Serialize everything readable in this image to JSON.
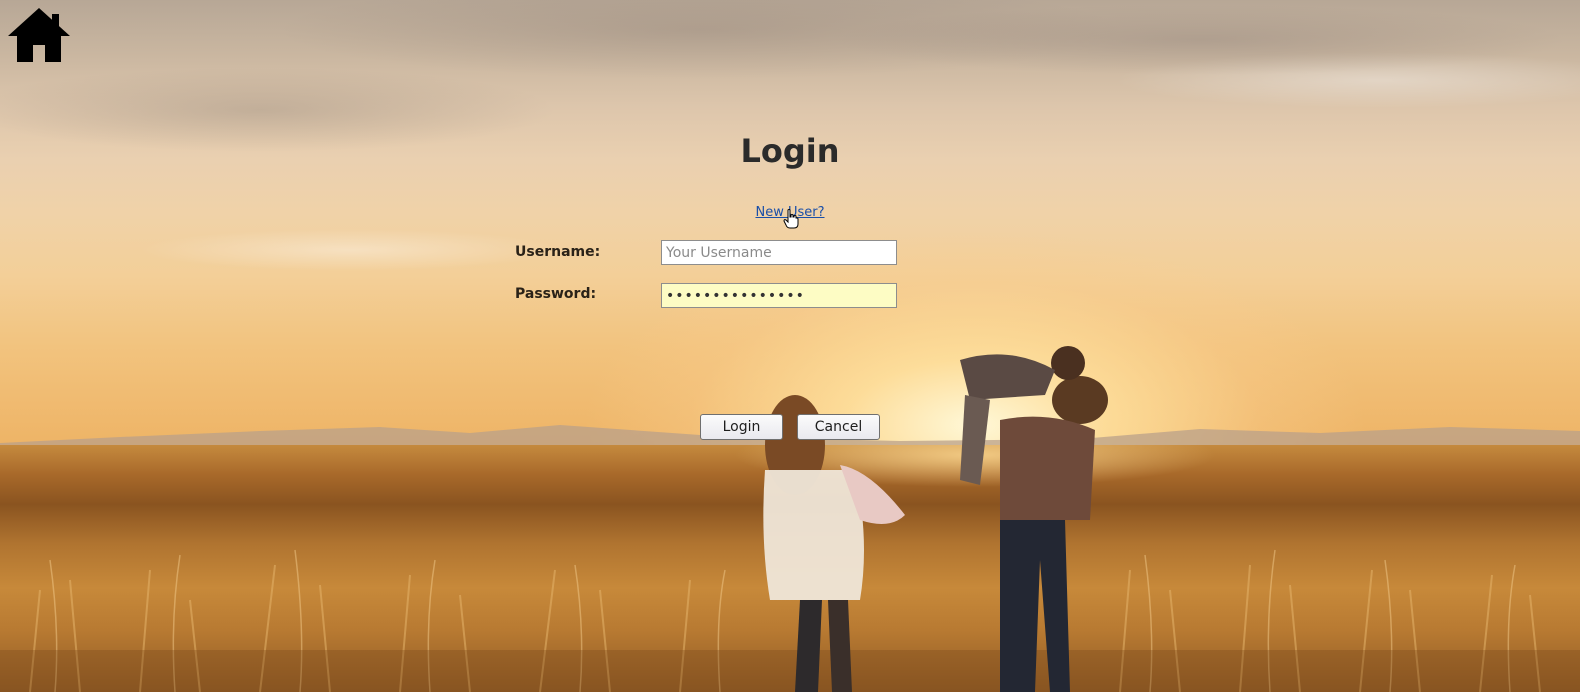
{
  "page": {
    "title": "Login",
    "new_user_link": "New User?"
  },
  "form": {
    "username_label": "Username:",
    "username_placeholder": "Your Username",
    "username_value": "",
    "password_label": "Password:",
    "password_value": "•••••••••••••••"
  },
  "actions": {
    "login_label": "Login",
    "cancel_label": "Cancel"
  },
  "icons": {
    "home": "home-icon",
    "cursor": "hand-pointer-icon"
  },
  "colors": {
    "link": "#1a4fa8",
    "title": "#2b2b2b",
    "password_autofill_bg": "#fdfcc4"
  }
}
